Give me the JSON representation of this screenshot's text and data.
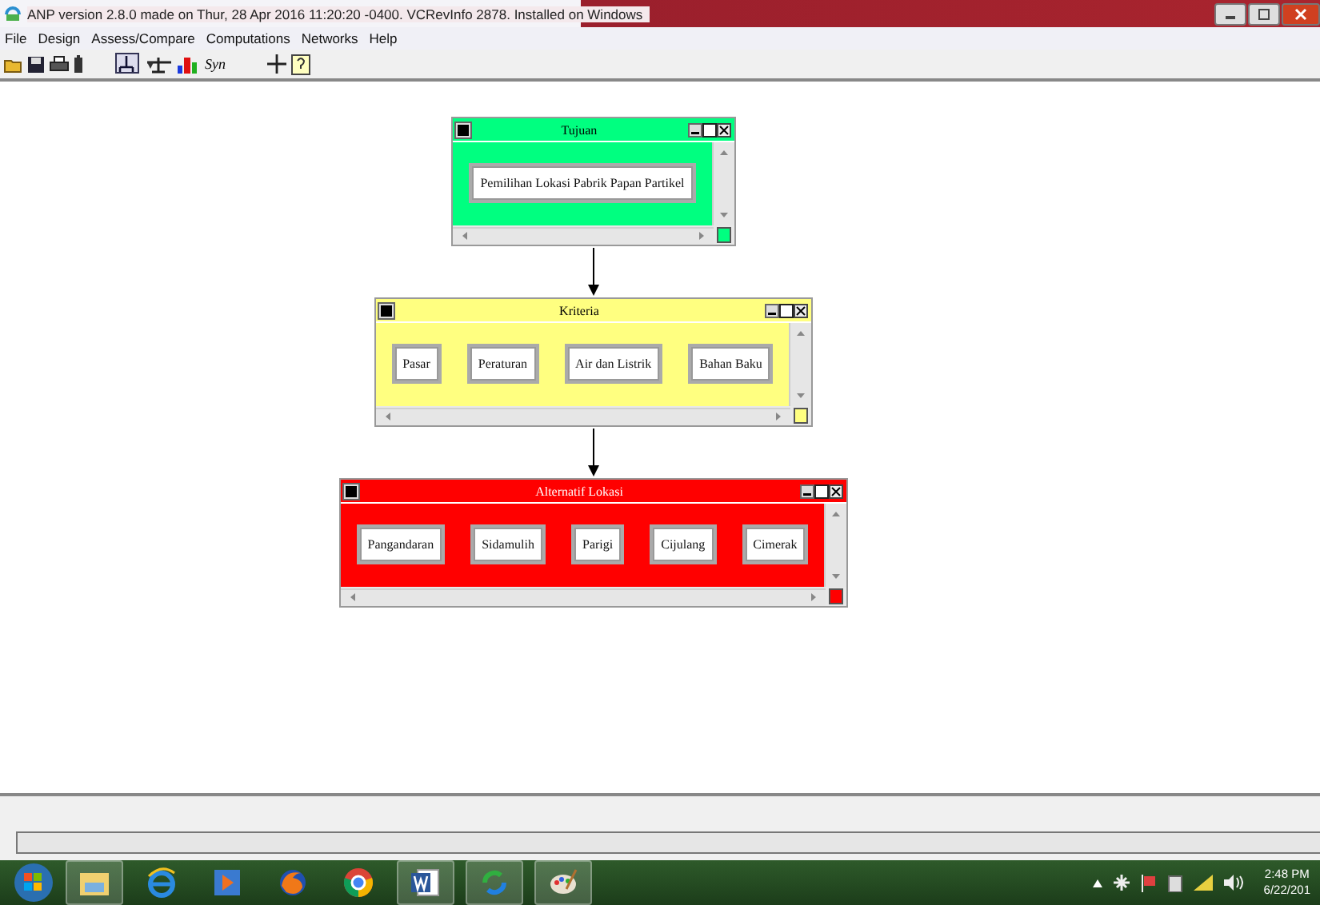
{
  "window": {
    "title": "ANP version 2.8.0 made on Thur, 28 Apr 2016 11:20:20 -0400.  VCRevInfo 2878. Installed on Windows"
  },
  "menu": [
    "File",
    "Design",
    "Assess/Compare",
    "Computations",
    "Networks",
    "Help"
  ],
  "toolbar": {
    "syn_label": "Syn"
  },
  "clusters": [
    {
      "name": "Tujuan",
      "color": "#00ff80",
      "nodes": [
        "Pemilihan Lokasi Pabrik Papan Partikel"
      ]
    },
    {
      "name": "Kriteria",
      "color": "#ffff80",
      "nodes": [
        "Pasar",
        "Peraturan",
        "Air dan Listrik",
        "Bahan Baku"
      ]
    },
    {
      "name": "Alternatif Lokasi",
      "color": "#ff0000",
      "nodes": [
        "Pangandaran",
        "Sidamulih",
        "Parigi",
        "Cijulang",
        "Cimerak"
      ]
    }
  ],
  "tray": {
    "time": "2:48 PM",
    "date": "6/22/201"
  }
}
